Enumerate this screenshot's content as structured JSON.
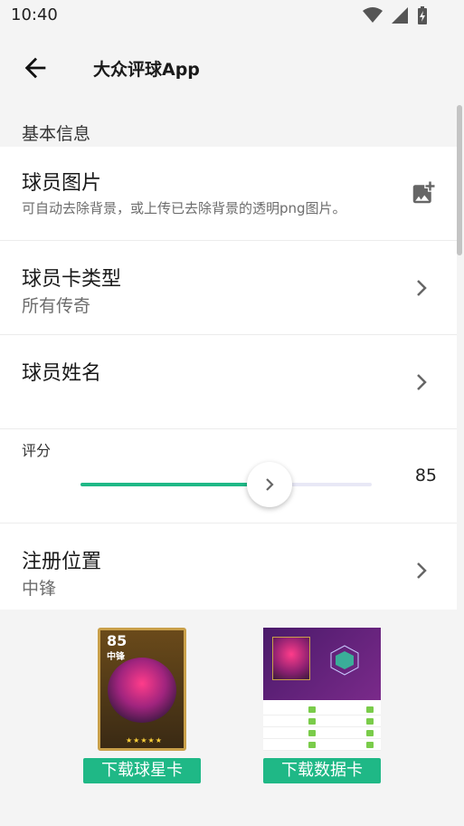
{
  "status_bar": {
    "time": "10:40"
  },
  "app_bar": {
    "title": "大众评球App"
  },
  "section": {
    "title": "基本信息"
  },
  "rows": {
    "image": {
      "title": "球员图片",
      "description": "可自动去除背景，或上传已去除背景的透明png图片。"
    },
    "card_type": {
      "title": "球员卡类型",
      "value": "所有传奇"
    },
    "name": {
      "title": "球员姓名",
      "value": ""
    },
    "rating": {
      "label": "评分",
      "value": "85",
      "fraction": 0.65
    },
    "position": {
      "title": "注册位置",
      "value": "中锋"
    }
  },
  "previews": {
    "player_card": {
      "rating": "85",
      "position": "中锋",
      "stars": "★★★★★"
    },
    "download_card_label": "下载球星卡",
    "download_data_label": "下载数据卡"
  },
  "colors": {
    "accent": "#1fb886",
    "slider_track": "#e8e8f6"
  },
  "icons": {
    "back": "arrow-back-icon",
    "add_photo": "add-photo-icon",
    "chevron": "chevron-right-icon"
  }
}
